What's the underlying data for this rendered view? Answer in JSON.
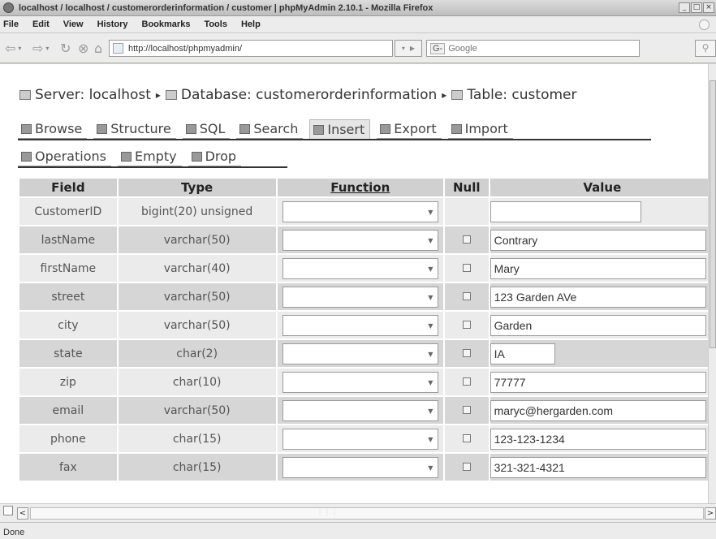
{
  "window": {
    "title": "localhost / localhost / customerorderinformation / customer | phpMyAdmin 2.10.1 - Mozilla Firefox"
  },
  "menu": [
    {
      "label": "File"
    },
    {
      "label": "Edit"
    },
    {
      "label": "View"
    },
    {
      "label": "History"
    },
    {
      "label": "Bookmarks"
    },
    {
      "label": "Tools"
    },
    {
      "label": "Help"
    }
  ],
  "nav": {
    "url": "http://localhost/phpmyadmin/",
    "search_engine": "G-",
    "search_placeholder": "Google"
  },
  "breadcrumb": {
    "server": "Server: localhost",
    "database": "Database: customerorderinformation",
    "table": "Table: customer"
  },
  "tabs": [
    {
      "label": "Browse"
    },
    {
      "label": "Structure"
    },
    {
      "label": "SQL"
    },
    {
      "label": "Search"
    },
    {
      "label": "Insert"
    },
    {
      "label": "Export"
    },
    {
      "label": "Import"
    },
    {
      "label": "Operations"
    },
    {
      "label": "Empty"
    },
    {
      "label": "Drop"
    }
  ],
  "active_tab": "Insert",
  "table_headers": {
    "field": "Field",
    "type": "Type",
    "function": "Function",
    "null": "Null",
    "value": "Value"
  },
  "rows": [
    {
      "field": "CustomerID",
      "type": "bigint(20) unsigned",
      "function": "",
      "nullable": false,
      "value": ""
    },
    {
      "field": "lastName",
      "type": "varchar(50)",
      "function": "",
      "nullable": true,
      "value": "Contrary"
    },
    {
      "field": "firstName",
      "type": "varchar(40)",
      "function": "",
      "nullable": true,
      "value": "Mary"
    },
    {
      "field": "street",
      "type": "varchar(50)",
      "function": "",
      "nullable": true,
      "value": "123 Garden AVe"
    },
    {
      "field": "city",
      "type": "varchar(50)",
      "function": "",
      "nullable": true,
      "value": "Garden"
    },
    {
      "field": "state",
      "type": "char(2)",
      "function": "",
      "nullable": true,
      "value": "IA"
    },
    {
      "field": "zip",
      "type": "char(10)",
      "function": "",
      "nullable": true,
      "value": "77777"
    },
    {
      "field": "email",
      "type": "varchar(50)",
      "function": "",
      "nullable": true,
      "value": "maryc@hergarden.com"
    },
    {
      "field": "phone",
      "type": "char(15)",
      "function": "",
      "nullable": true,
      "value": "123-123-1234"
    },
    {
      "field": "fax",
      "type": "char(15)",
      "function": "",
      "nullable": true,
      "value": "321-321-4321"
    }
  ],
  "status": "Done"
}
